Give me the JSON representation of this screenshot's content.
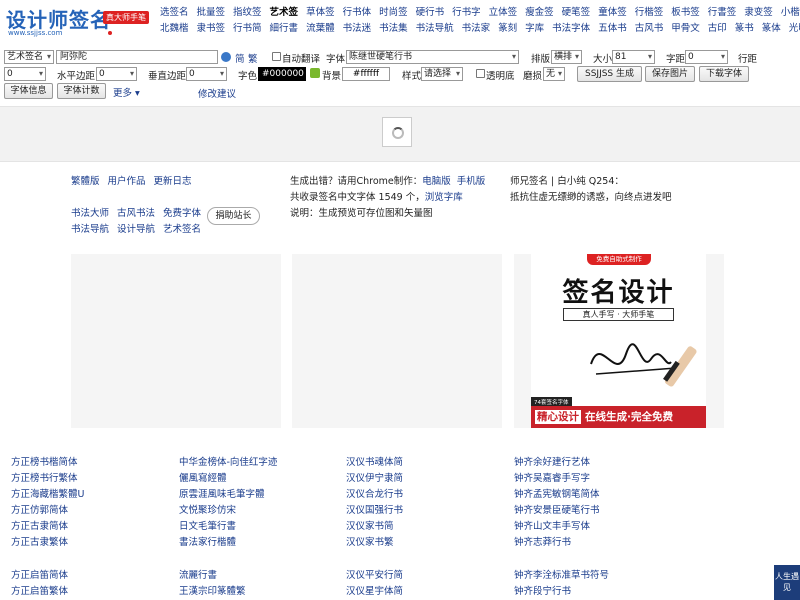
{
  "logo": {
    "title": "设计师签名",
    "badge": "真大师手笔",
    "url": "www.ssjjss.com"
  },
  "nav": {
    "row1": [
      "选签名",
      "批量签",
      "指纹签",
      "艺术签",
      "草体签",
      "行书体",
      "时尚签",
      "硬行书",
      "行书字",
      "立体签",
      "瘦金签",
      "硬笔签",
      "童体签",
      "行楷签",
      "板书签",
      "行書签",
      "隶变签",
      "小楷签"
    ],
    "row2": [
      "北魏楷",
      "隶书签",
      "行书简",
      "細行書",
      "流葉體",
      "书法迷",
      "书法集",
      "书法导航",
      "书法家",
      "篆刻",
      "字库",
      "书法字体",
      "五体书",
      "古风书",
      "甲骨文",
      "古印",
      "篆书",
      "篆体",
      "光明书"
    ],
    "active": "艺术签"
  },
  "toolbar": {
    "type_select": "艺术签名",
    "name_value": "阿弥陀",
    "jian": "简",
    "fan": "繁",
    "auto_translate": "自动翻译",
    "font_label": "字体",
    "font_select": "陈继世硬笔行书",
    "layout_label": "排版",
    "layout_select": "横排",
    "size_label": "大小",
    "size_select": "81",
    "char_spacing_label": "字距",
    "char_spacing_select": "0",
    "line_spacing_label": "行距",
    "row2_first_select": "0",
    "h_margin_label": "水平边距",
    "h_margin_select": "0",
    "v_margin_label": "垂直边距",
    "v_margin_select": "0",
    "color_label": "字色",
    "color_value": "#000000",
    "bg_label": "背景",
    "bg_value": "#ffffff",
    "style_label": "样式",
    "style_select": "请选择",
    "transparent_label": "透明底",
    "wear_label": "磨损",
    "wear_select": "无",
    "generate_button": "SSJJSS 生成",
    "save_button": "保存图片",
    "download_button": "下载字体",
    "font_info_button": "字体信息",
    "font_count_button": "字体计数",
    "more_label": "更多",
    "suggest_link": "修改建议"
  },
  "info": {
    "col1_row1": [
      "繁體版",
      "用户作品",
      "更新日志"
    ],
    "col1_row2": [
      "书法大师",
      "古风书法",
      "免费字体"
    ],
    "col1_row3": [
      "书法导航",
      "设计导航",
      "艺术签名"
    ],
    "donate": "捐助站长",
    "col2_line1_text": "生成出错？请用Chrome制作：",
    "col2_line1_links": [
      "电脑版",
      "手机版"
    ],
    "col2_line2_text": "共收录签名中文字体 1549 个，",
    "col2_line2_link": "浏览字库",
    "col2_line3": "说明：生成预览可存位图和矢量图",
    "col3_line1": "师兄签名 | 白小纯 Q254：",
    "col3_line2": "抵抗住虚无缥缈的诱惑，向终点进发吧"
  },
  "ad": {
    "top": "免费自助式制作",
    "title": "签名设计",
    "sub": "真人手写 · 大师手笔",
    "tag": "74套签名字体",
    "bottom1": "精心设计",
    "bottom2": "在线生成·完全免费"
  },
  "fontlists": {
    "col1_a": [
      "方正榜书楷简体",
      "方正榜书行繁体",
      "方正海藏楷繁體U",
      "方正仿郭简体",
      "方正古隶简体",
      "方正古隶繁体"
    ],
    "col2_a": [
      "中华金榜体-向佳红字迹",
      "儷風寫經體",
      "原雲涯風味毛筆字體",
      "文悦聚珍仿宋",
      "日文毛筆行書",
      "書法家行楷體"
    ],
    "col3_a": [
      "汉仪书魂体简",
      "汉仪伊宁隶简",
      "汉仪合龙行书",
      "汉仪国强行书",
      "汉仪家书简",
      "汉仪家书繁"
    ],
    "col4_a": [
      "钟齐余好建行艺体",
      "钟齐吴嘉睿手写字",
      "钟齐孟宪敏钢笔简体",
      "钟齐安景臣硬笔行书",
      "钟齐山文丰手写体",
      "钟齐志莽行书"
    ],
    "col1_b": [
      "方正启笛简体",
      "方正启笛繁体"
    ],
    "col2_b": [
      "流麗行書",
      "王漢宗印篆體繁"
    ],
    "col3_b": [
      "汉仪平安行简",
      "汉仪星宇体简"
    ],
    "col4_b": [
      "钟齐李洤标准草书符号",
      "钟齐段宁行书"
    ]
  },
  "side_tag": "人生遇见"
}
